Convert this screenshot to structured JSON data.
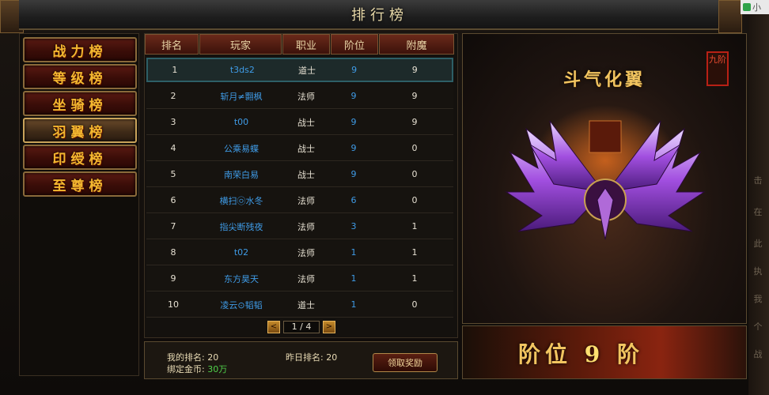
{
  "window": {
    "title": "排行榜"
  },
  "topright": {
    "label": "小"
  },
  "side_text": [
    "击",
    "在",
    "此",
    "执",
    "我",
    "个",
    "战"
  ],
  "nav": [
    {
      "label": "战力榜",
      "active": false
    },
    {
      "label": "等级榜",
      "active": false
    },
    {
      "label": "坐骑榜",
      "active": false
    },
    {
      "label": "羽翼榜",
      "active": true
    },
    {
      "label": "印绶榜",
      "active": false
    },
    {
      "label": "至尊榜",
      "active": false
    }
  ],
  "table": {
    "headers": [
      "排名",
      "玩家",
      "职业",
      "阶位",
      "附魔"
    ],
    "rows": [
      {
        "rank": "1",
        "player": "t3ds2",
        "job": "道士",
        "tier": "9",
        "enchant": "9"
      },
      {
        "rank": "2",
        "player": "斩月≠翾枫",
        "job": "法师",
        "tier": "9",
        "enchant": "9"
      },
      {
        "rank": "3",
        "player": "t00",
        "job": "战士",
        "tier": "9",
        "enchant": "9"
      },
      {
        "rank": "4",
        "player": "公乘易蝶",
        "job": "战士",
        "tier": "9",
        "enchant": "0"
      },
      {
        "rank": "5",
        "player": "南荣白易",
        "job": "战士",
        "tier": "9",
        "enchant": "0"
      },
      {
        "rank": "6",
        "player": "横扫㉧水冬",
        "job": "法师",
        "tier": "6",
        "enchant": "0"
      },
      {
        "rank": "7",
        "player": "指尖断残夜",
        "job": "法师",
        "tier": "3",
        "enchant": "1"
      },
      {
        "rank": "8",
        "player": "t02",
        "job": "法师",
        "tier": "1",
        "enchant": "1"
      },
      {
        "rank": "9",
        "player": "东方昊天",
        "job": "法师",
        "tier": "1",
        "enchant": "1"
      },
      {
        "rank": "10",
        "player": "凌云⊙韬韬",
        "job": "道士",
        "tier": "1",
        "enchant": "0"
      }
    ]
  },
  "pager": {
    "prev": "<",
    "next": ">",
    "page": "1 / 4"
  },
  "info": {
    "my_rank_label": "我的排名:",
    "my_rank": "20",
    "yesterday_label": "昨日排名:",
    "yesterday": "20",
    "gold_label": "绑定金币:",
    "gold": "30万",
    "claim_label": "领取奖励"
  },
  "showcase": {
    "title": "斗气化翼",
    "seal": "九阶",
    "tier_text": "阶位",
    "tier_num": "9",
    "tier_suffix": "阶"
  },
  "colors": {
    "accent_gold": "#f3b830",
    "player_blue": "#3f9be6",
    "gold_green": "#4fd24a"
  }
}
